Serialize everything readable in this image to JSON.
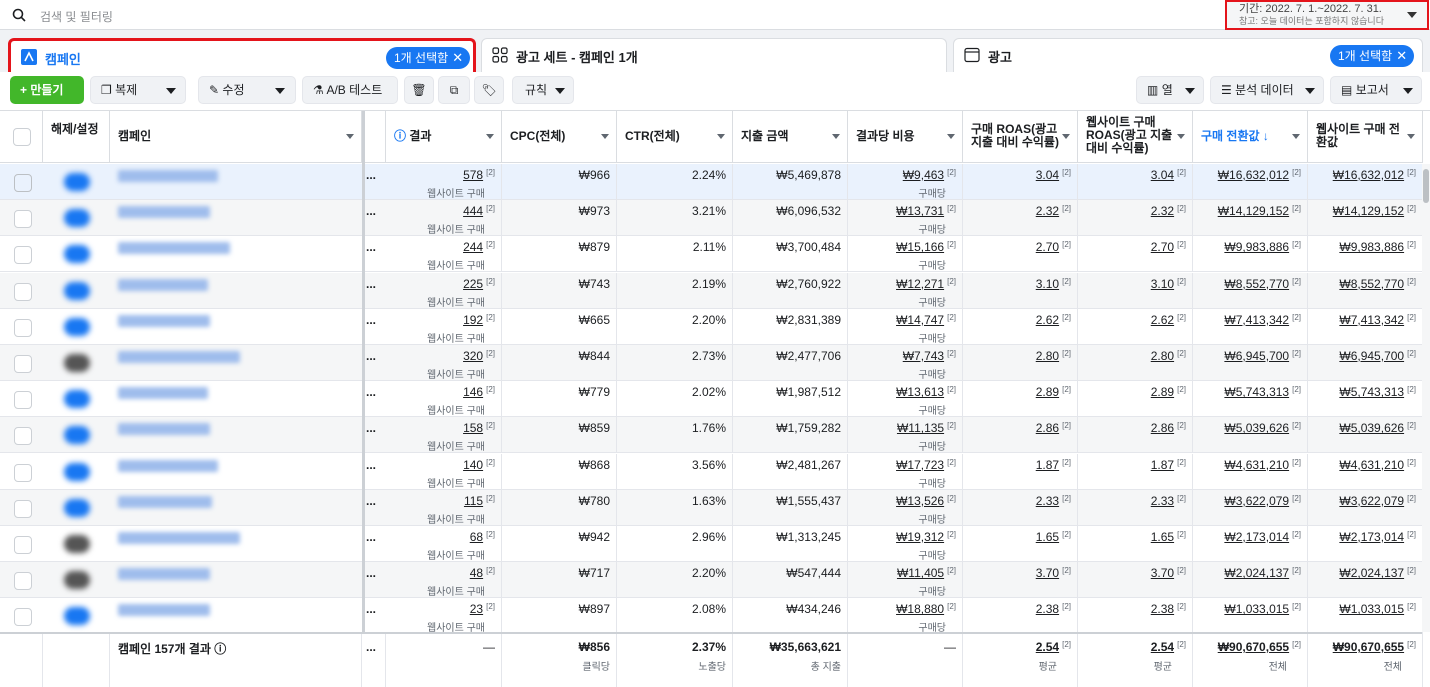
{
  "search": {
    "placeholder": "검색 및 필터링",
    "icon": "search-icon"
  },
  "date_range": {
    "label": "기간: 2022. 7. 1.~2022. 7. 31.",
    "note": "참고: 오늘 데이터는 포함하지 않습니다"
  },
  "tabs": [
    {
      "label": "캠페인",
      "icon": "campaign-icon",
      "badge": "1개 선택함"
    },
    {
      "label": "광고 세트 - 캠페인 1개",
      "icon": "adset-grid-icon"
    },
    {
      "label": "광고",
      "icon": "ad-window-icon",
      "badge": "1개 선택함"
    }
  ],
  "toolbar": {
    "create": "+ 만들기",
    "duplicate": "복제",
    "edit": "수정",
    "ab_test": "A/B 테스트",
    "rules": "규칙",
    "columns": "열",
    "breakdown": "분석 데이터",
    "reports": "보고서"
  },
  "columns": {
    "toggle": "해제/설정",
    "campaign": "캠페인",
    "results": "결과",
    "cpc": "CPC(전체)",
    "ctr": "CTR(전체)",
    "spend": "지출 금액",
    "cost_per_result": "결과당 비용",
    "purchase_roas": "구매 ROAS(광고 지출 대비 수익률)",
    "web_roas": "웹사이트 구매 ROAS(광고 지출 대비 수익률)",
    "conv_value": "구매 전환값 ↓",
    "web_conv_value": "웹사이트 구매 전환값"
  },
  "labels": {
    "result_unit": "웹사이트 구매",
    "cost_unit": "구매당",
    "sup": "[2]",
    "more": "..."
  },
  "rows": [
    {
      "toggle": "on",
      "name_w": 100,
      "results": "578",
      "cpc": "₩966",
      "ctr": "2.24%",
      "spend": "₩5,469,878",
      "cpr": "₩9,463",
      "roas": "3.04",
      "web_roas": "3.04",
      "cv": "₩16,632,012",
      "wcv": "₩16,632,012"
    },
    {
      "toggle": "on",
      "name_w": 92,
      "results": "444",
      "cpc": "₩973",
      "ctr": "3.21%",
      "spend": "₩6,096,532",
      "cpr": "₩13,731",
      "roas": "2.32",
      "web_roas": "2.32",
      "cv": "₩14,129,152",
      "wcv": "₩14,129,152"
    },
    {
      "toggle": "on",
      "name_w": 112,
      "results": "244",
      "cpc": "₩879",
      "ctr": "2.11%",
      "spend": "₩3,700,484",
      "cpr": "₩15,166",
      "roas": "2.70",
      "web_roas": "2.70",
      "cv": "₩9,983,886",
      "wcv": "₩9,983,886"
    },
    {
      "toggle": "on",
      "name_w": 90,
      "results": "225",
      "cpc": "₩743",
      "ctr": "2.19%",
      "spend": "₩2,760,922",
      "cpr": "₩12,271",
      "roas": "3.10",
      "web_roas": "3.10",
      "cv": "₩8,552,770",
      "wcv": "₩8,552,770"
    },
    {
      "toggle": "on",
      "name_w": 92,
      "results": "192",
      "cpc": "₩665",
      "ctr": "2.20%",
      "spend": "₩2,831,389",
      "cpr": "₩14,747",
      "roas": "2.62",
      "web_roas": "2.62",
      "cv": "₩7,413,342",
      "wcv": "₩7,413,342"
    },
    {
      "toggle": "off",
      "name_w": 122,
      "results": "320",
      "cpc": "₩844",
      "ctr": "2.73%",
      "spend": "₩2,477,706",
      "cpr": "₩7,743",
      "roas": "2.80",
      "web_roas": "2.80",
      "cv": "₩6,945,700",
      "wcv": "₩6,945,700"
    },
    {
      "toggle": "on",
      "name_w": 90,
      "results": "146",
      "cpc": "₩779",
      "ctr": "2.02%",
      "spend": "₩1,987,512",
      "cpr": "₩13,613",
      "roas": "2.89",
      "web_roas": "2.89",
      "cv": "₩5,743,313",
      "wcv": "₩5,743,313"
    },
    {
      "toggle": "on",
      "name_w": 92,
      "results": "158",
      "cpc": "₩859",
      "ctr": "1.76%",
      "spend": "₩1,759,282",
      "cpr": "₩11,135",
      "roas": "2.86",
      "web_roas": "2.86",
      "cv": "₩5,039,626",
      "wcv": "₩5,039,626"
    },
    {
      "toggle": "on",
      "name_w": 100,
      "results": "140",
      "cpc": "₩868",
      "ctr": "3.56%",
      "spend": "₩2,481,267",
      "cpr": "₩17,723",
      "roas": "1.87",
      "web_roas": "1.87",
      "cv": "₩4,631,210",
      "wcv": "₩4,631,210"
    },
    {
      "toggle": "on",
      "name_w": 94,
      "results": "115",
      "cpc": "₩780",
      "ctr": "1.63%",
      "spend": "₩1,555,437",
      "cpr": "₩13,526",
      "roas": "2.33",
      "web_roas": "2.33",
      "cv": "₩3,622,079",
      "wcv": "₩3,622,079"
    },
    {
      "toggle": "off",
      "name_w": 122,
      "results": "68",
      "cpc": "₩942",
      "ctr": "2.96%",
      "spend": "₩1,313,245",
      "cpr": "₩19,312",
      "roas": "1.65",
      "web_roas": "1.65",
      "cv": "₩2,173,014",
      "wcv": "₩2,173,014"
    },
    {
      "toggle": "off",
      "name_w": 92,
      "results": "48",
      "cpc": "₩717",
      "ctr": "2.20%",
      "spend": "₩547,444",
      "cpr": "₩11,405",
      "roas": "3.70",
      "web_roas": "3.70",
      "cv": "₩2,024,137",
      "wcv": "₩2,024,137"
    },
    {
      "toggle": "on",
      "name_w": 92,
      "results": "23",
      "cpc": "₩897",
      "ctr": "2.08%",
      "spend": "₩434,246",
      "cpr": "₩18,880",
      "roas": "2.38",
      "web_roas": "2.38",
      "cv": "₩1,033,015",
      "wcv": "₩1,033,015"
    }
  ],
  "totals": {
    "label": "캠페인 157개 결과",
    "more": "...",
    "results": "—",
    "cpc": "₩856",
    "cpc_sub": "클릭당",
    "ctr": "2.37%",
    "ctr_sub": "노출당",
    "spend": "₩35,663,621",
    "spend_sub": "총 지출",
    "cpr": "—",
    "roas": "2.54",
    "roas_sub": "평균",
    "web_roas": "2.54",
    "web_roas_sub": "평균",
    "cv": "₩90,670,655",
    "cv_sub": "전체",
    "wcv": "₩90,670,655",
    "wcv_sub": "전체"
  },
  "colors": {
    "accent": "#1877f2",
    "create": "#42b72a",
    "highlight": "#e4141b"
  }
}
